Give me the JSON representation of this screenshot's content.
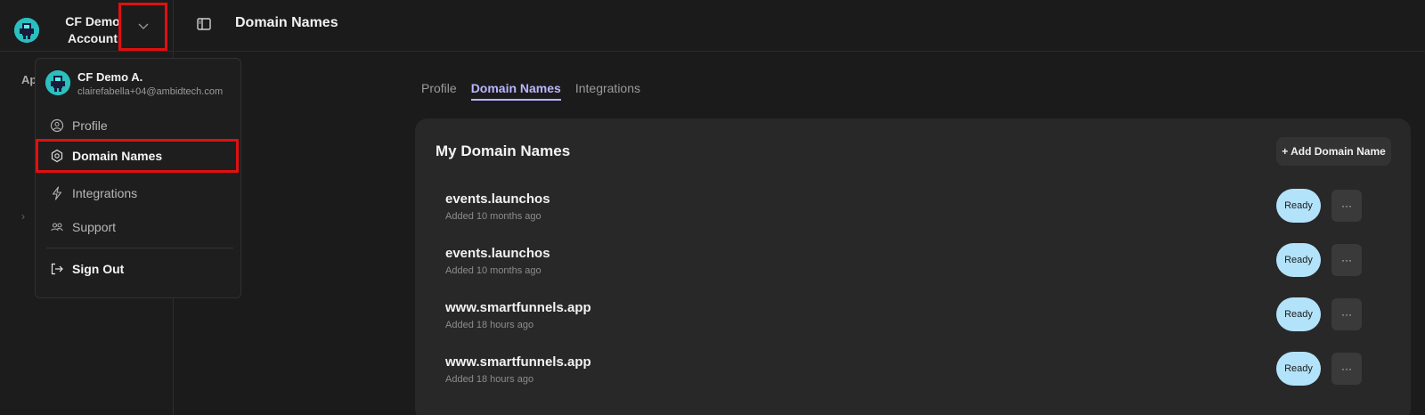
{
  "account": {
    "name": "CF Demo Account"
  },
  "header": {
    "page_title": "Domain Names"
  },
  "sidebar": {
    "apps_label": "Ap",
    "chevron": "›"
  },
  "tabs": [
    {
      "label": "Profile",
      "active": false
    },
    {
      "label": "Domain Names",
      "active": true
    },
    {
      "label": "Integrations",
      "active": false
    }
  ],
  "card": {
    "title": "My Domain Names",
    "add_button": "+ Add Domain Name"
  },
  "domains": [
    {
      "name": "events.launchos",
      "added": "Added 10 months ago",
      "status": "Ready",
      "more": "···"
    },
    {
      "name": "events.launchos",
      "added": "Added 10 months ago",
      "status": "Ready",
      "more": "···"
    },
    {
      "name": "www.smartfunnels.app",
      "added": "Added 18 hours ago",
      "status": "Ready",
      "more": "···"
    },
    {
      "name": "www.smartfunnels.app",
      "added": "Added 18 hours ago",
      "status": "Ready",
      "more": "···"
    }
  ],
  "dropdown": {
    "user_name": "CF Demo A.",
    "user_email": "clairefabella+04@ambidtech.com",
    "items": [
      {
        "label": "Profile",
        "icon": "user-circle-icon"
      },
      {
        "label": "Domain Names",
        "icon": "globe-icon"
      },
      {
        "label": "Integrations",
        "icon": "lightning-icon"
      },
      {
        "label": "Support",
        "icon": "users-icon"
      }
    ],
    "sign_out": "Sign Out"
  },
  "colors": {
    "background": "#1b1b1b",
    "card": "#282828",
    "accent_tab": "#b9b6ff",
    "ready_badge": "#b3e3fb",
    "highlight_box": "#e01010"
  }
}
